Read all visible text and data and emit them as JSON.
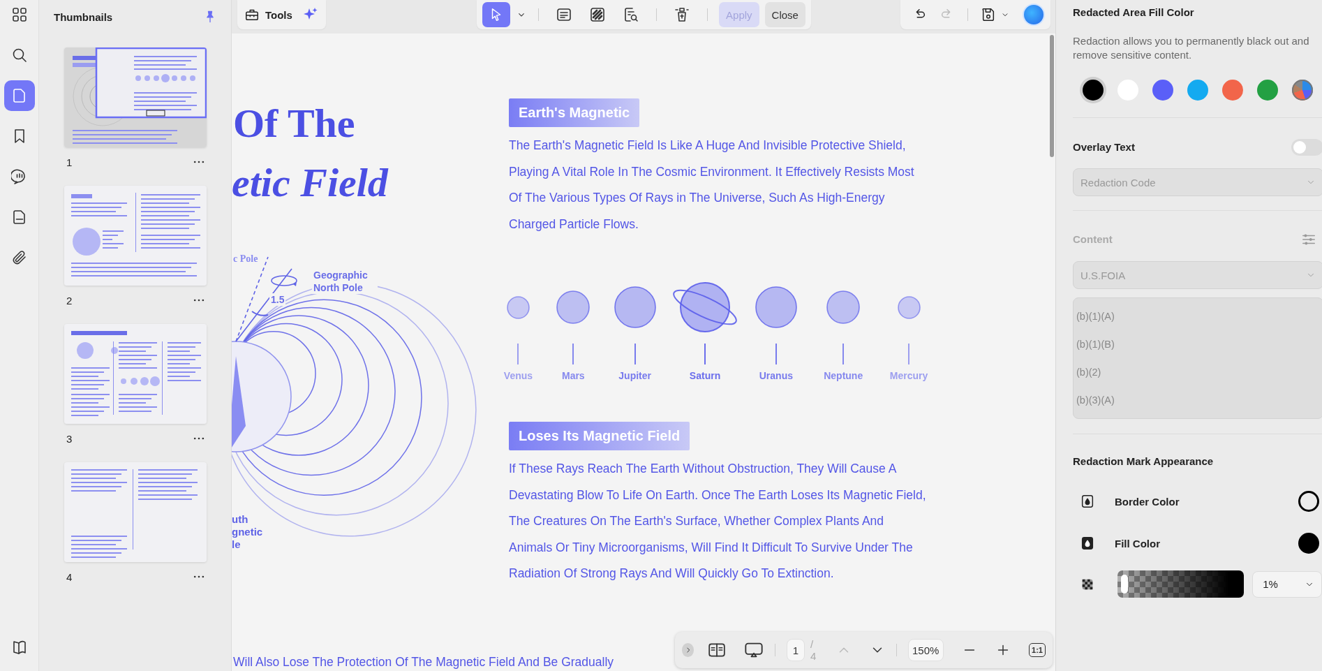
{
  "rail": {
    "items": [
      {
        "kind": "apps",
        "selected": false
      },
      {
        "kind": "search",
        "selected": false
      },
      {
        "kind": "pages",
        "selected": true
      },
      {
        "kind": "bookmark",
        "selected": false
      },
      {
        "kind": "comment",
        "selected": false
      },
      {
        "kind": "form",
        "selected": false
      },
      {
        "kind": "attachment",
        "selected": false
      },
      {
        "kind": "reader",
        "selected": false
      }
    ]
  },
  "thumbnails": {
    "title": "Thumbnails",
    "pinned": true,
    "pages": [
      {
        "label": "1",
        "selected": true
      },
      {
        "label": "2",
        "selected": false
      },
      {
        "label": "3",
        "selected": false
      },
      {
        "label": "4",
        "selected": false
      }
    ]
  },
  "toolbar": {
    "tools_label": "Tools",
    "redact_tools": [
      {
        "kind": "select",
        "selected": true
      },
      {
        "kind": "redact-text",
        "selected": false
      },
      {
        "kind": "redact-area",
        "selected": false
      },
      {
        "kind": "search-redact",
        "selected": false
      },
      {
        "kind": "redact-pages",
        "selected": false
      }
    ],
    "apply": {
      "label": "Apply",
      "disabled": true
    },
    "close": {
      "label": "Close"
    },
    "undo": {
      "disabled": false
    },
    "redo": {
      "disabled": true
    }
  },
  "document": {
    "title_lines": [
      "Of The",
      "etic Field"
    ],
    "diagram": {
      "pole": "c Pole",
      "north": "Geographic North Pole",
      "angle": "1.5",
      "south_lines": [
        "uth",
        "gnetic",
        "le"
      ]
    },
    "sections": [
      {
        "heading": "Earth's Magnetic",
        "body": "The Earth's Magnetic Field Is Like A Huge And Invisible Protective Shield, Playing A Vital Role In The Cosmic Environment. It Effectively Resists Most Of The Various Types Of Rays in The Universe, Such As High-Energy Charged Particle Flows."
      },
      {
        "heading": "Loses Its Magnetic Field",
        "body": "If These Rays Reach The Earth Without Obstruction, They Will Cause A Devastating Blow To Life On Earth. Once The Earth Loses Its Magnetic Field, The Creatures On The Earth's Surface, Whether Complex Plants And Animals Or Tiny Microorganisms, Will Find It Difficult To Survive Under The Radiation Of Strong Rays And Will Quickly Go To Extinction."
      }
    ],
    "planets": [
      {
        "name": "Venus",
        "kind": "plain"
      },
      {
        "name": "Mars",
        "kind": "plain"
      },
      {
        "name": "Jupiter",
        "kind": "plain"
      },
      {
        "name": "Saturn",
        "kind": "ringed"
      },
      {
        "name": "Uranus",
        "kind": "plain"
      },
      {
        "name": "Neptune",
        "kind": "plain"
      },
      {
        "name": "Mercury",
        "kind": "plain"
      }
    ],
    "footer_text": "Will Also Lose The Protection Of The Magnetic Field And Be Gradually"
  },
  "nav": {
    "page": "1",
    "total": "/ 4",
    "prev_disabled": true,
    "next_disabled": false,
    "zoom": "150%",
    "actual_size": "1:1"
  },
  "panel": {
    "fill_title": "Redacted Area Fill Color",
    "description": "Redaction allows you to permanently black out and remove sensitive content.",
    "fill_colors": [
      {
        "kind": "swatch",
        "color": "#000000",
        "selected": true
      },
      {
        "kind": "swatch",
        "color": "#ffffff",
        "selected": false
      },
      {
        "kind": "swatch",
        "color": "#5a5ff8",
        "selected": false
      },
      {
        "kind": "swatch",
        "color": "#14aaf0",
        "selected": false
      },
      {
        "kind": "swatch",
        "color": "#f2654a",
        "selected": false
      },
      {
        "kind": "swatch",
        "color": "#23a043",
        "selected": false
      },
      {
        "kind": "custom",
        "selected": false
      }
    ],
    "overlay": {
      "label": "Overlay Text",
      "on": false
    },
    "code_select": {
      "value": "Redaction Code",
      "disabled": true
    },
    "content": {
      "label": "Content",
      "disabled": true,
      "select": "U.S.FOIA",
      "codes": [
        "(b)(1)(A)",
        "(b)(1)(B)",
        "(b)(2)",
        "(b)(3)(A)"
      ]
    },
    "mark_title": "Redaction Mark Appearance",
    "border": {
      "label": "Border Color",
      "color": "#000000"
    },
    "fill": {
      "label": "Fill Color",
      "color": "#000000"
    },
    "opacity": {
      "level": 0.01,
      "value": "1%"
    }
  }
}
